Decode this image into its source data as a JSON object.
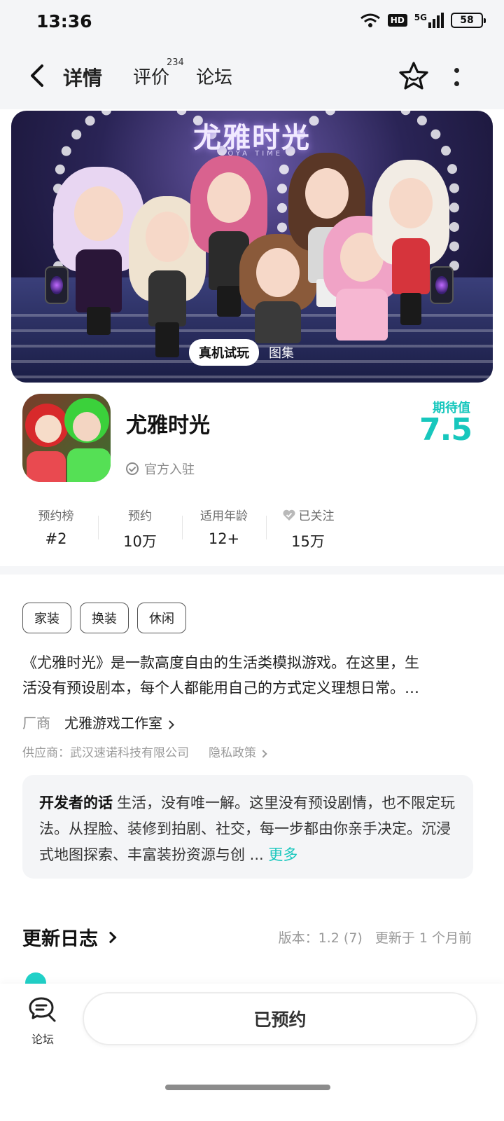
{
  "status_bar": {
    "time": "13:36",
    "hd": "HD",
    "network": "5G",
    "battery": "58"
  },
  "nav": {
    "back_icon": "back-arrow-icon",
    "tabs": [
      {
        "label": "详情",
        "active": true
      },
      {
        "label": "评价",
        "badge": "234"
      },
      {
        "label": "论坛"
      }
    ],
    "favorite_icon": "star-icon",
    "more_icon": "more-vertical-icon"
  },
  "banner": {
    "logo_text": "尤雅时光",
    "logo_sub": "YOYA TIME",
    "pills": {
      "active": "真机试玩",
      "inactive": "图集"
    }
  },
  "app": {
    "title": "尤雅时光",
    "verified": "官方入驻",
    "expect_label": "期待值",
    "expect_value": "7.5"
  },
  "stats": [
    {
      "label": "预约榜",
      "value": "#2"
    },
    {
      "label": "预约",
      "value": "10万"
    },
    {
      "label": "适用年龄",
      "value": "12+"
    },
    {
      "label": "已关注",
      "value": "15万",
      "icon": "heart-icon"
    }
  ],
  "tags": [
    "家装",
    "换装",
    "休闲"
  ],
  "description": {
    "line1": "《尤雅时光》是一款高度自由的生活类模拟游戏。在这里，生",
    "line2": "活没有预设剧本，每个人都能用自己的方式定义理想日常。…"
  },
  "vendor": {
    "label": "厂商",
    "name": "尤雅游戏工作室"
  },
  "supplier": {
    "text": "供应商：武汉速诺科技有限公司",
    "privacy": "隐私政策"
  },
  "developer": {
    "title": "开发者的话",
    "text": "生活，没有唯一解。这里没有预设剧情，也不限定玩法。从捏脸、装修到拍剧、社交，每一步都由你亲手决定。沉浸式地图探索、丰富装扮资源与创 ...",
    "more": "更多"
  },
  "changelog": {
    "title": "更新日志",
    "version": "版本：1.2 (7)",
    "updated": "更新于 1 个月前"
  },
  "bottom": {
    "forum_label": "论坛",
    "reserve_label": "已预约"
  },
  "colors": {
    "accent": "#17c7bd",
    "tab_underline": "#21d1c8"
  }
}
